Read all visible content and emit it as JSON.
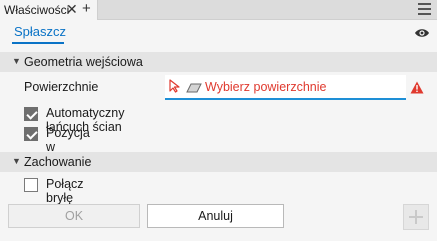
{
  "tab": {
    "title": "Właściwości",
    "close_glyph": "✕",
    "add_glyph": "+"
  },
  "header": {
    "subtab_label": "Spłaszcz"
  },
  "sections": {
    "input_geometry": {
      "title": "Geometria wejściowa",
      "surfaces_label": "Powierzchnie",
      "surfaces_placeholder": "Wybierz powierzchnie",
      "auto_chain_label": "Automatyczny łańcuch ścian",
      "auto_chain_checked": true,
      "origin_position_label": "Pozycja w początku",
      "origin_position_checked": true
    },
    "behavior": {
      "title": "Zachowanie",
      "combine_label": "Połącz bryłę wynikową",
      "combine_checked": false
    }
  },
  "buttons": {
    "ok_label": "OK",
    "cancel_label": "Anuluj"
  },
  "icons": {
    "menu": "hamburger-menu-icon",
    "visibility": "eye-icon",
    "select": "cursor-arrow-icon",
    "face": "face-parallelogram-icon",
    "warning": "warning-triangle-icon",
    "add": "plus-icon"
  },
  "colors": {
    "accent": "#0a73c6",
    "error": "#e03a2f",
    "select_underline": "#1e8fd6"
  }
}
